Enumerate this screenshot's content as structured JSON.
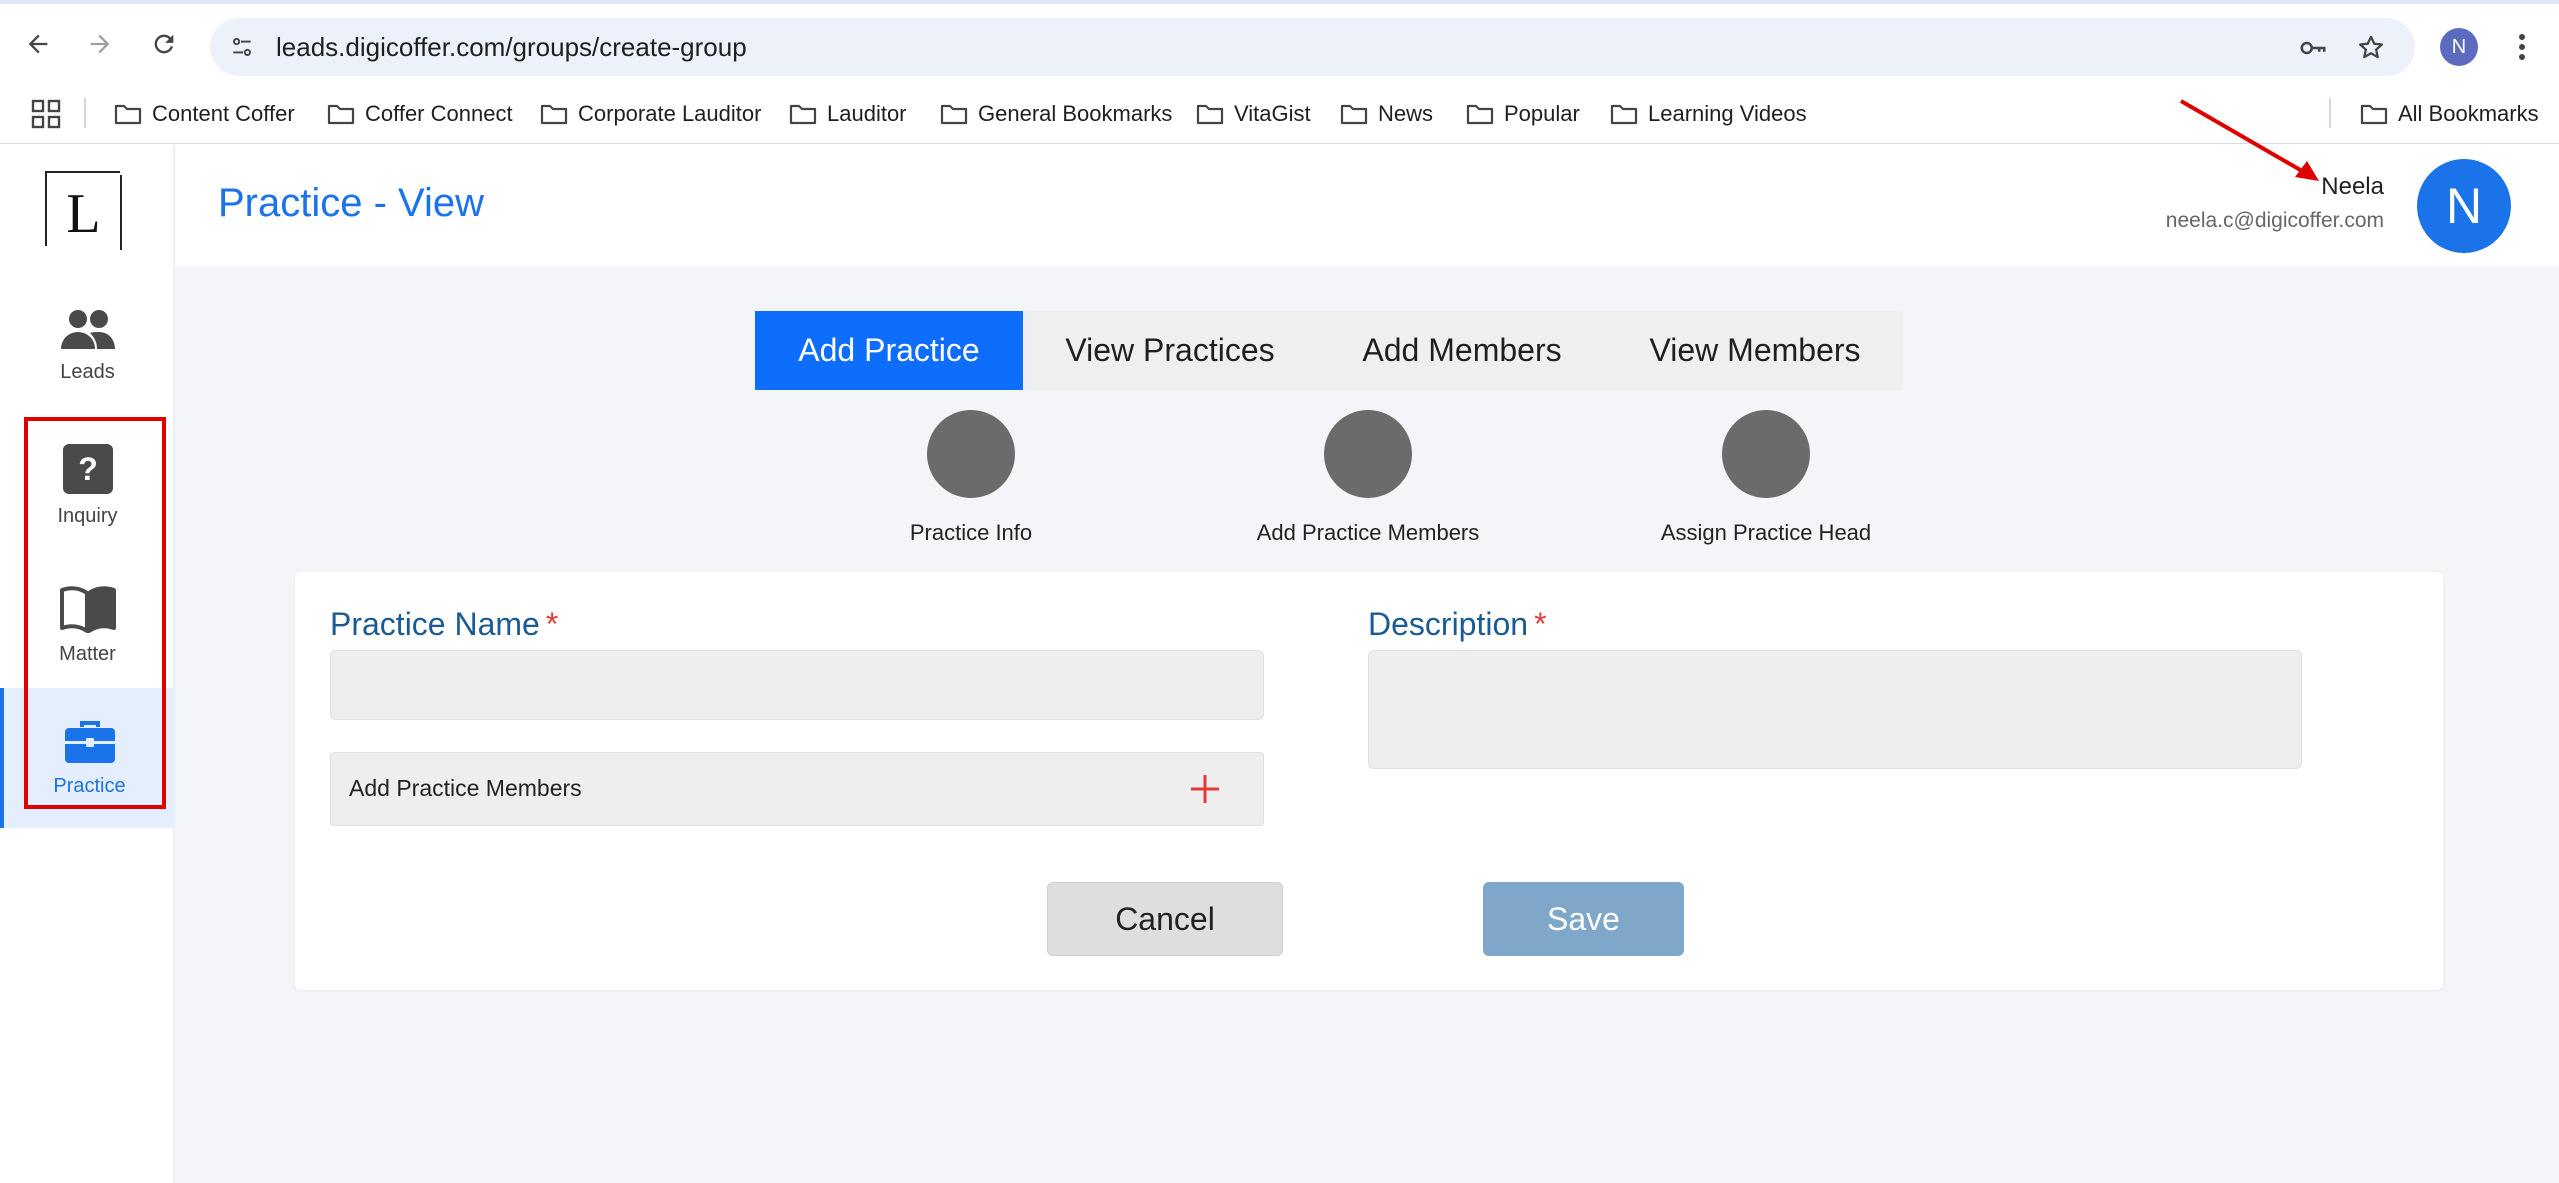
{
  "browser": {
    "url": "leads.digicoffer.com/groups/create-group",
    "profile_initial": "N",
    "bookmarks": [
      "Content Coffer",
      "Coffer Connect",
      "Corporate Lauditor",
      "Lauditor",
      "General Bookmarks",
      "VitaGist",
      "News",
      "Popular",
      "Learning Videos"
    ],
    "all_bookmarks": "All Bookmarks"
  },
  "sidebar": {
    "logo_letter": "L",
    "items": [
      {
        "label": "Leads",
        "icon": "people-icon"
      },
      {
        "label": "Inquiry",
        "icon": "question-icon"
      },
      {
        "label": "Matter",
        "icon": "book-icon"
      },
      {
        "label": "Practice",
        "icon": "briefcase-icon",
        "active": true
      }
    ]
  },
  "header": {
    "title": "Practice - View",
    "user_name": "Neela",
    "user_email": "neela.c@digicoffer.com",
    "avatar_initial": "N"
  },
  "tabs": [
    {
      "label": "Add Practice",
      "active": true
    },
    {
      "label": "View Practices"
    },
    {
      "label": "Add Members"
    },
    {
      "label": "View Members"
    }
  ],
  "steps": [
    "Practice Info",
    "Add Practice Members",
    "Assign Practice Head"
  ],
  "form": {
    "practice_name_label": "Practice Name",
    "description_label": "Description",
    "required_mark": "*",
    "practice_name_value": "",
    "description_value": "",
    "add_members_label": "Add Practice Members",
    "cancel_label": "Cancel",
    "save_label": "Save"
  },
  "colors": {
    "accent": "#1a73e8",
    "tab_active": "#0d6efd",
    "label": "#1b5b94",
    "required": "#e53935",
    "save_disabled": "#7fa7c9",
    "annotation": "#e00000"
  }
}
